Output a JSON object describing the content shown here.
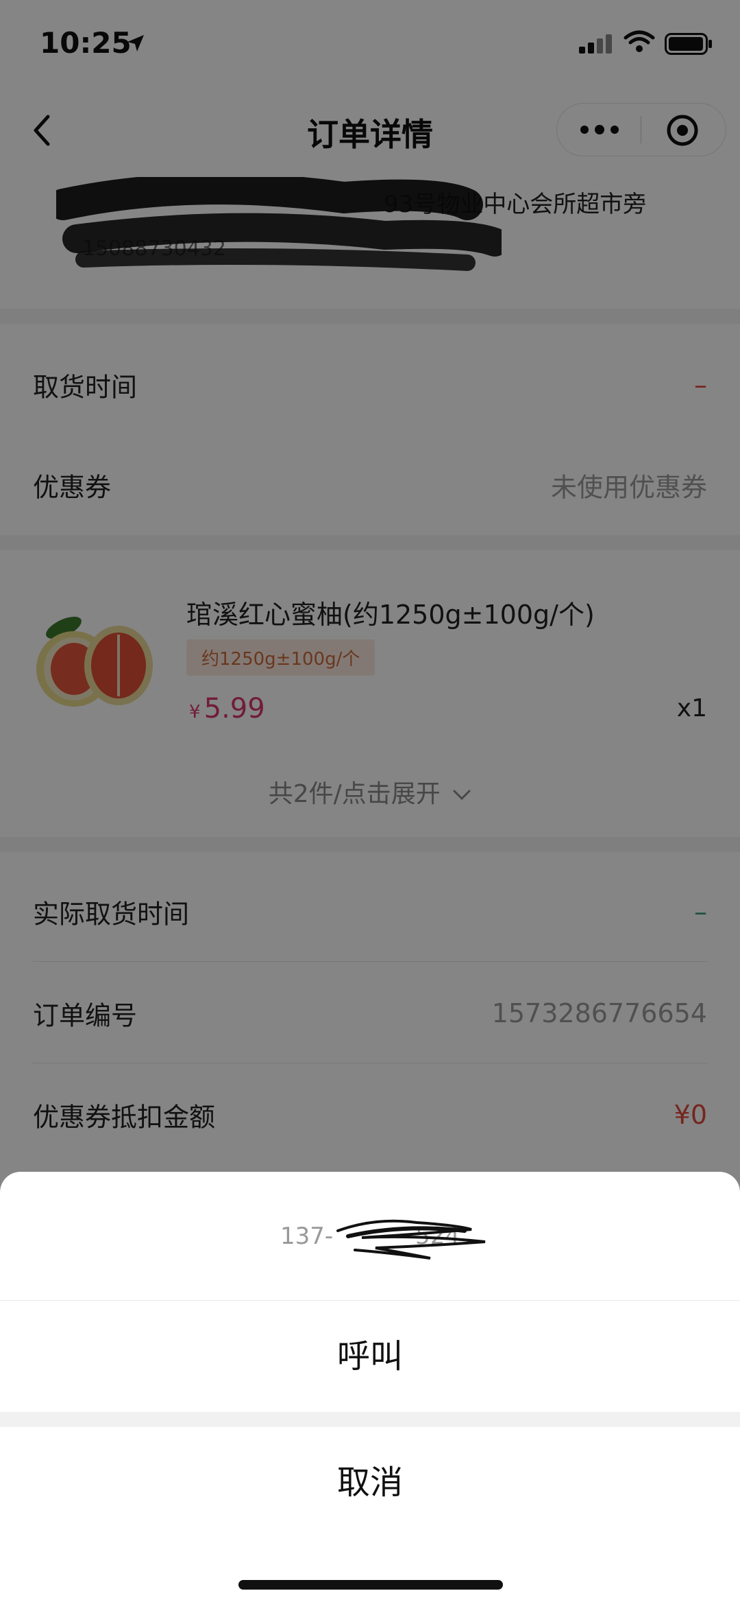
{
  "status_bar": {
    "time": "10:25"
  },
  "nav": {
    "title": "订单详情"
  },
  "address": {
    "line": "93号物业中心会所超市旁",
    "phone": "15088730432"
  },
  "rows": {
    "pickup_time": {
      "label": "取货时间",
      "value": "–"
    },
    "coupon": {
      "label": "优惠券",
      "value": "未使用优惠券"
    },
    "actual_pickup": {
      "label": "实际取货时间",
      "value": "–"
    },
    "order_no": {
      "label": "订单编号",
      "value": "1573286776654"
    },
    "coupon_discount": {
      "label": "优惠券抵扣金额",
      "value": "¥0"
    }
  },
  "product": {
    "name": "琯溪红心蜜柚(约1250g±100g/个)",
    "spec": "约1250g±100g/个",
    "price_symbol": "¥",
    "price": "5.99",
    "qty": "x1",
    "expand": "共2件/点击展开"
  },
  "sheet": {
    "phone": "137-",
    "phone_tail": "524",
    "call": "呼叫",
    "cancel": "取消"
  },
  "colors": {
    "price": "#d9376e",
    "accent_red": "#e04a3a",
    "accent_green": "#3aa07a"
  }
}
